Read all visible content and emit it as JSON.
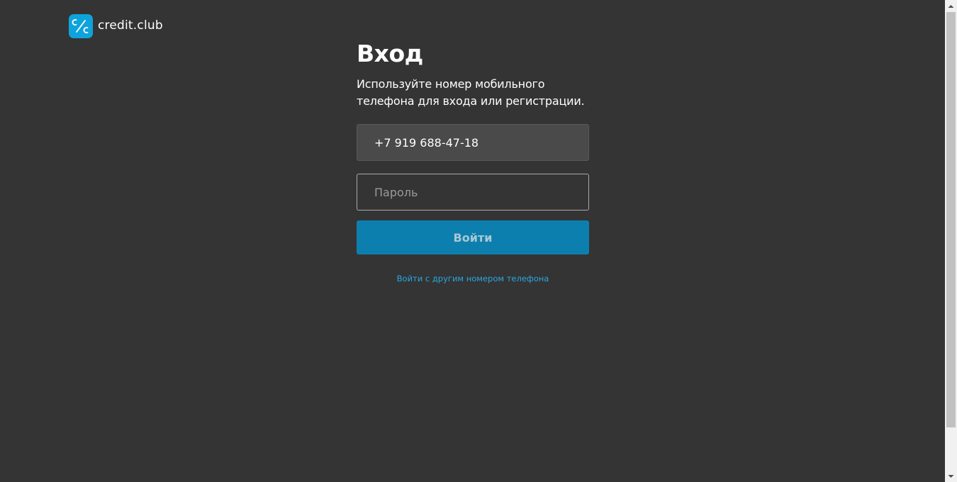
{
  "brand": {
    "name": "credit.club",
    "logo_icon": "percent-c-icon",
    "accent_color": "#0fa3dc"
  },
  "login": {
    "title": "Вход",
    "subtitle": "Используйте номер мобильного телефона для входа или регистрации.",
    "phone_value": "+7 919 688-47-18",
    "password_placeholder": "Пароль",
    "submit_label": "Войти",
    "other_number_link": "Войти с другим номером телефона"
  },
  "colors": {
    "background": "#343434",
    "button": "#0d7fae",
    "link": "#2aa7e0"
  }
}
